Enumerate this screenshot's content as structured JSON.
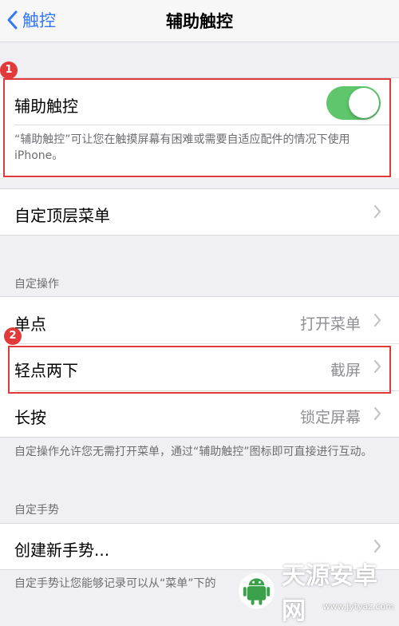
{
  "nav": {
    "back_label": "触控",
    "title": "辅助触控"
  },
  "main_toggle": {
    "label": "辅助触控",
    "state": "on",
    "description": "“辅助触控”可让您在触摸屏幕有困难或需要自适应配件的情况下使用 iPhone。"
  },
  "top_menu": {
    "label": "自定顶层菜单"
  },
  "custom_actions": {
    "header": "自定操作",
    "rows": [
      {
        "label": "单点",
        "value": "打开菜单"
      },
      {
        "label": "轻点两下",
        "value": "截屏"
      },
      {
        "label": "长按",
        "value": "锁定屏幕"
      }
    ],
    "footer": "自定操作允许您无需打开菜单，通过“辅助触控”图标即可直接进行互动。"
  },
  "custom_gestures": {
    "header": "自定手势",
    "create_label": "创建新手势...",
    "footer": "自定手势让您能够记录可以从“菜单”下的"
  },
  "annotations": {
    "badge_1": "1",
    "badge_2": "2"
  },
  "watermark": {
    "text": "天源安卓网",
    "url": "www.jytyaz.com"
  },
  "colors": {
    "accent": "#3478f6",
    "toggle_on": "#5fc66b",
    "highlight": "#e23a3a"
  },
  "icons": [
    "back-chevron-icon",
    "chevron-right-icon",
    "android-logo-icon"
  ]
}
